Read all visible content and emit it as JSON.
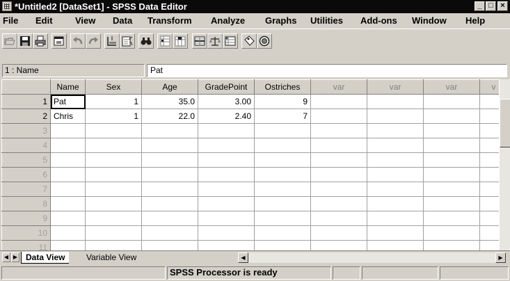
{
  "window": {
    "title": "*Untitled2 [DataSet1] - SPSS Data Editor",
    "minimize_glyph": "_",
    "maximize_glyph": "□",
    "close_glyph": "×"
  },
  "menu": [
    {
      "label": "File",
      "icon": "none"
    },
    {
      "label": "Edit"
    },
    {
      "label": "View"
    },
    {
      "label": "Data"
    },
    {
      "label": "Transform"
    },
    {
      "label": "Analyze"
    },
    {
      "label": "Graphs"
    },
    {
      "label": "Utilities"
    },
    {
      "label": "Add-ons"
    },
    {
      "label": "Window"
    },
    {
      "label": "Help"
    }
  ],
  "toolbar": {
    "icons": [
      "open-icon",
      "save-icon",
      "print-icon",
      "dialog-recall-icon",
      "undo-icon",
      "redo-icon",
      "goto-case-icon",
      "variables-icon",
      "find-icon",
      "insert-cases-icon",
      "insert-variable-icon",
      "split-file-icon",
      "weight-cases-icon",
      "select-cases-icon",
      "value-labels-icon",
      "use-sets-icon"
    ]
  },
  "cell_editor": {
    "reference": "1 : Name",
    "value": "Pat"
  },
  "grid": {
    "columns": [
      "Name",
      "Sex",
      "Age",
      "GradePoint",
      "Ostriches",
      "var",
      "var",
      "var",
      "v"
    ],
    "rows": [
      {
        "num": "1",
        "cells": [
          "Pat",
          "1",
          "35.0",
          "3.00",
          "9",
          "",
          "",
          "",
          ""
        ]
      },
      {
        "num": "2",
        "cells": [
          "Chris",
          "1",
          "22.0",
          "2.40",
          "7",
          "",
          "",
          "",
          ""
        ]
      },
      {
        "num": "3",
        "cells": [
          "",
          "",
          "",
          "",
          "",
          "",
          "",
          "",
          ""
        ]
      },
      {
        "num": "4",
        "cells": [
          "",
          "",
          "",
          "",
          "",
          "",
          "",
          "",
          ""
        ]
      },
      {
        "num": "5",
        "cells": [
          "",
          "",
          "",
          "",
          "",
          "",
          "",
          "",
          ""
        ]
      },
      {
        "num": "6",
        "cells": [
          "",
          "",
          "",
          "",
          "",
          "",
          "",
          "",
          ""
        ]
      },
      {
        "num": "7",
        "cells": [
          "",
          "",
          "",
          "",
          "",
          "",
          "",
          "",
          ""
        ]
      },
      {
        "num": "8",
        "cells": [
          "",
          "",
          "",
          "",
          "",
          "",
          "",
          "",
          ""
        ]
      },
      {
        "num": "9",
        "cells": [
          "",
          "",
          "",
          "",
          "",
          "",
          "",
          "",
          ""
        ]
      },
      {
        "num": "10",
        "cells": [
          "",
          "",
          "",
          "",
          "",
          "",
          "",
          "",
          ""
        ]
      },
      {
        "num": "11",
        "cells": [
          "",
          "",
          "",
          "",
          "",
          "",
          "",
          "",
          ""
        ]
      }
    ]
  },
  "tabs": {
    "data_view": "Data View",
    "variable_view": "Variable View"
  },
  "status": {
    "message": "SPSS Processor  is ready"
  }
}
